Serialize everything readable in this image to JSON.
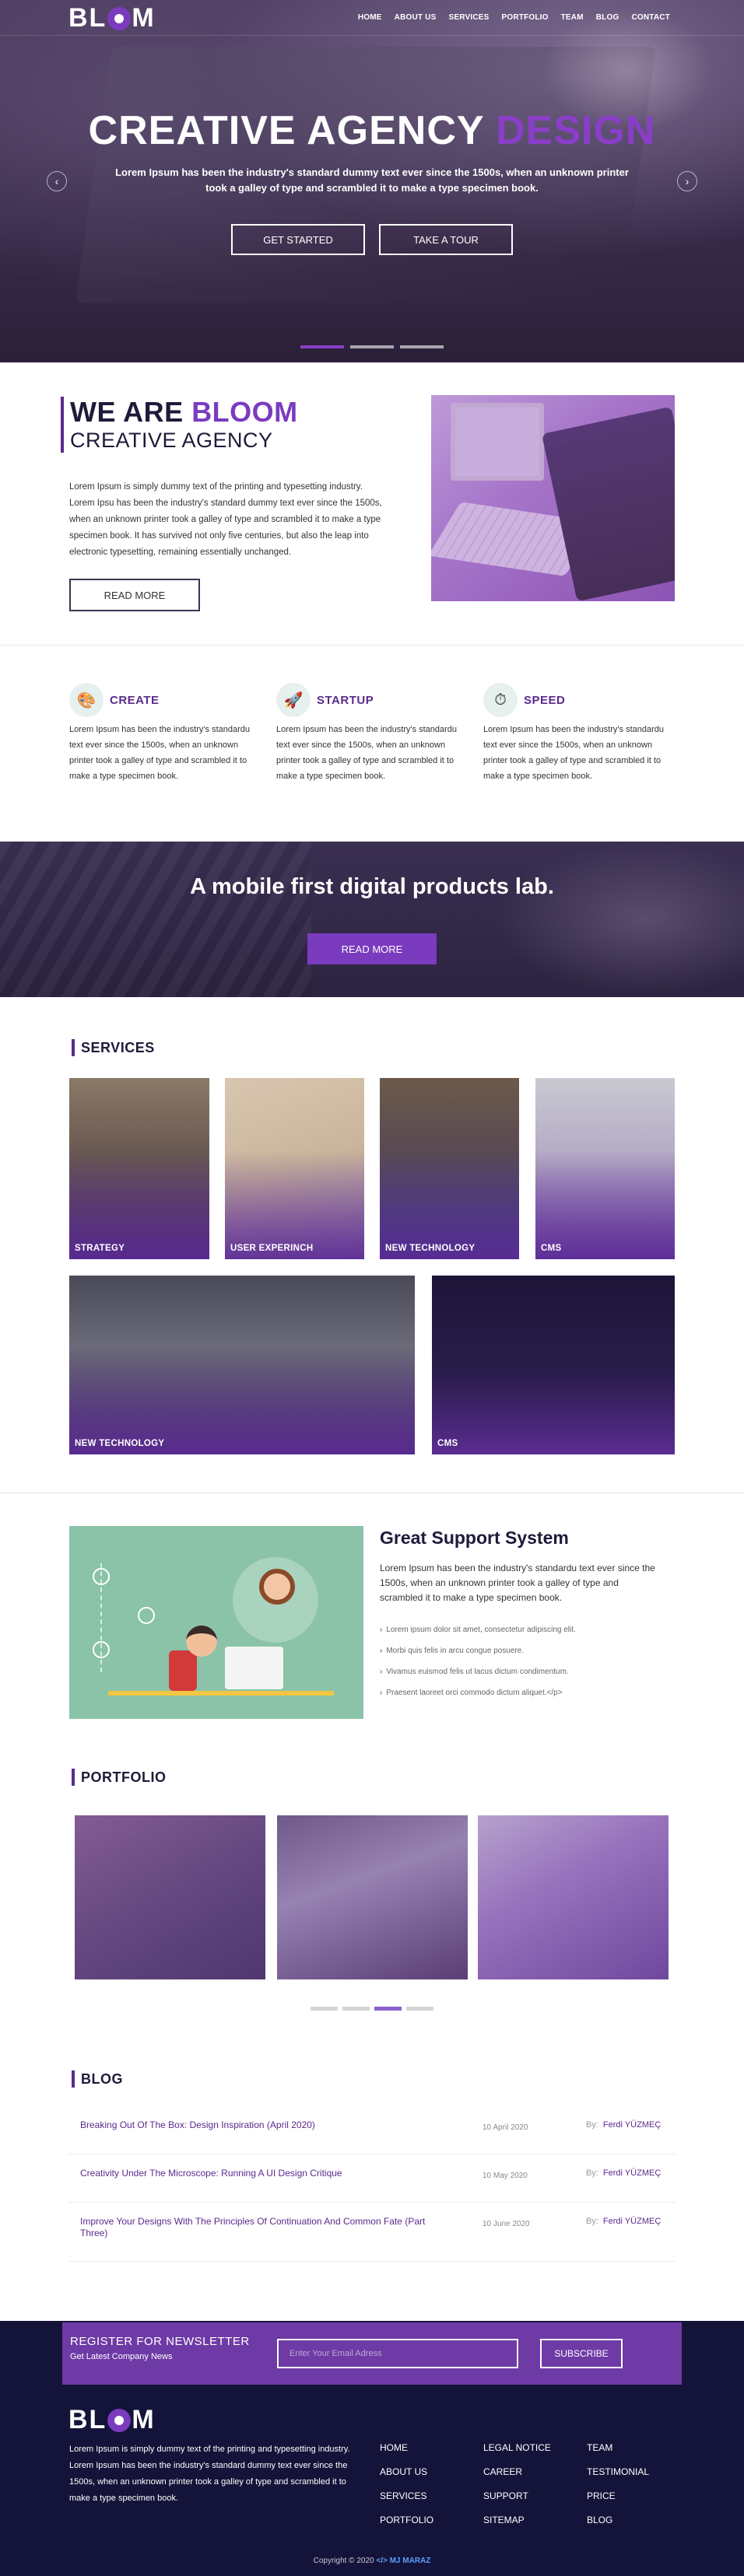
{
  "brand": {
    "name_pre": "BL",
    "name_post": "M"
  },
  "nav": [
    "HOME",
    "ABOUT US",
    "SERVICES",
    "PORTFOLIO",
    "TEAM",
    "BLOG",
    "CONTACT"
  ],
  "hero": {
    "title_main": "CREATIVE AGENCY",
    "title_accent": "DESIGN",
    "subtitle": "Lorem Ipsum has been the industry's standard dummy text ever since the 1500s, when an unknown printer took a galley of type and scrambled it to make a type specimen book.",
    "btn_start": "GET STARTED",
    "btn_tour": "TAKE A TOUR",
    "prev": "‹",
    "next": "›"
  },
  "about": {
    "line1_pre": "WE ARE",
    "line1_accent": "BLOOM",
    "line2": "CREATIVE AGENCY",
    "text": "Lorem Ipsum is simply dummy text of the printing and typesetting industry. Lorem Ipsu has been the industry's standard dummy text ever since the 1500s, when an unknown printer took a galley of type and scrambled it to make a type specimen book. It has survived not only five centuries, but also the leap into electronic typesetting, remaining essentially unchanged.",
    "btn": "READ MORE"
  },
  "features": [
    {
      "title": "CREATE",
      "icon": "paint-icon",
      "text": "Lorem Ipsum has been the industry's standardu text ever since the 1500s, when an unknown printer took a galley of type and scrambled it to make a type specimen book."
    },
    {
      "title": "STARTUP",
      "icon": "rocket-icon",
      "text": "Lorem Ipsum has been the industry's standardu text ever since the 1500s, when an unknown printer took a galley of type and scrambled it to make a type specimen book."
    },
    {
      "title": "SPEED",
      "icon": "speedometer-icon",
      "text": "Lorem Ipsum has been the industry's standardu text ever since the 1500s, when an unknown printer took a galley of type and scrambled it to make a type specimen book."
    }
  ],
  "cta": {
    "title": "A mobile first digital products lab.",
    "btn": "READ MORE"
  },
  "services": {
    "title": "SERVICES",
    "items": [
      "STRATEGY",
      "USER EXPERINCH",
      "NEW TECHNOLOGY",
      "CMS",
      "NEW TECHNOLOGY",
      "CMS"
    ]
  },
  "support": {
    "title": "Great Support System",
    "text": "Lorem Ipsum has been the industry's standardu text ever since the 1500s, when an unknown printer took a galley of type and scrambled it to make a type specimen book.",
    "list": [
      "Lorem ipsum dolor sit amet, consectetur adipiscing elit.",
      "Morbi quis felis in arcu congue posuere.",
      "Vivamus euismod felis ut lacus dictum condimentum.",
      "Praesent laoreet orci commodo dictum aliquet.</p>"
    ]
  },
  "portfolio": {
    "title": "PORTFOLIO"
  },
  "blog": {
    "title": "BLOG",
    "by": "By:",
    "posts": [
      {
        "title": "Breaking Out Of The Box: Design Inspiration (April 2020)",
        "date": "10 April 2020",
        "author": "Ferdi YÜZMEÇ"
      },
      {
        "title": "Creativity Under The Microscope: Running A UI Design Critique",
        "date": "10 May 2020",
        "author": "Ferdi YÜZMEÇ"
      },
      {
        "title": "Improve Your Designs With The Principles Of Continuation And Common Fate (Part Three)",
        "date": "10 June 2020",
        "author": "Ferdi YÜZMEÇ"
      }
    ]
  },
  "newsletter": {
    "title": "REGISTER FOR NEWSLETTER",
    "subtitle": "Get Latest Company News",
    "placeholder": "Enter Your Email Adress",
    "btn": "SUBSCRIBE"
  },
  "footer": {
    "text": "Lorem Ipsum is simply dummy text of the printing and typesetting industry. Lorem Ipsum has been the industry's standard dummy text ever since the 1500s, when an unknown printer took a galley of type and scrambled it to make a type specimen book.",
    "col1": [
      "HOME",
      "ABOUT US",
      "SERVICES",
      "PORTFOLIO"
    ],
    "col2": [
      "LEGAL NOTICE",
      "CAREER",
      "SUPPORT",
      "SITEMAP"
    ],
    "col3": [
      "TEAM",
      "TESTIMONIAL",
      "PRICE",
      "BLOG"
    ],
    "copyright": "Copyright © 2020",
    "author": "</> MJ MARAZ"
  },
  "colors": {
    "accent": "#7a3bbf",
    "dark": "#141339",
    "newsletter": "#6e3aa5"
  }
}
